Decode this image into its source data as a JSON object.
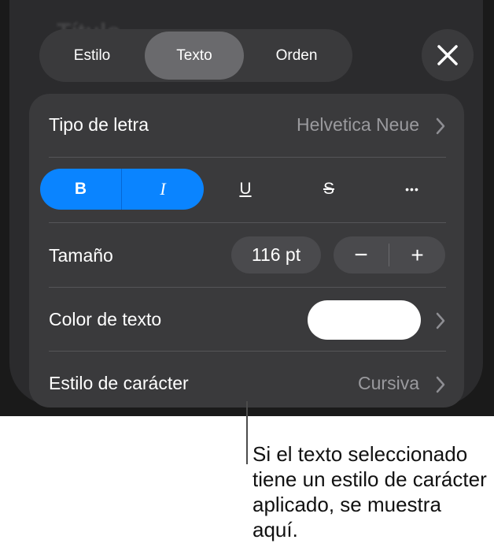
{
  "panel": {
    "title": "Título"
  },
  "tabs": [
    {
      "label": "Estilo",
      "active": false
    },
    {
      "label": "Texto",
      "active": true
    },
    {
      "label": "Orden",
      "active": false
    }
  ],
  "close": {
    "icon": "close-icon"
  },
  "font_row": {
    "label": "Tipo de letra",
    "value": "Helvetica Neue"
  },
  "style_buttons": {
    "bold": "B",
    "italic": "I",
    "underline": "U",
    "strikethrough": "S",
    "more": "•••"
  },
  "size_row": {
    "label": "Tamaño",
    "value": "116 pt",
    "decrement": "−",
    "increment": "+"
  },
  "color_row": {
    "label": "Color de texto",
    "swatch_color": "#ffffff"
  },
  "char_style_row": {
    "label": "Estilo de carácter",
    "value": "Cursiva"
  },
  "callout": {
    "text": "Si el texto seleccionado tiene un estilo de carácter aplicado, se muestra aquí."
  },
  "colors": {
    "accent": "#0a84ff",
    "panel": "#2b2b2d",
    "card": "#3a3a3c"
  }
}
